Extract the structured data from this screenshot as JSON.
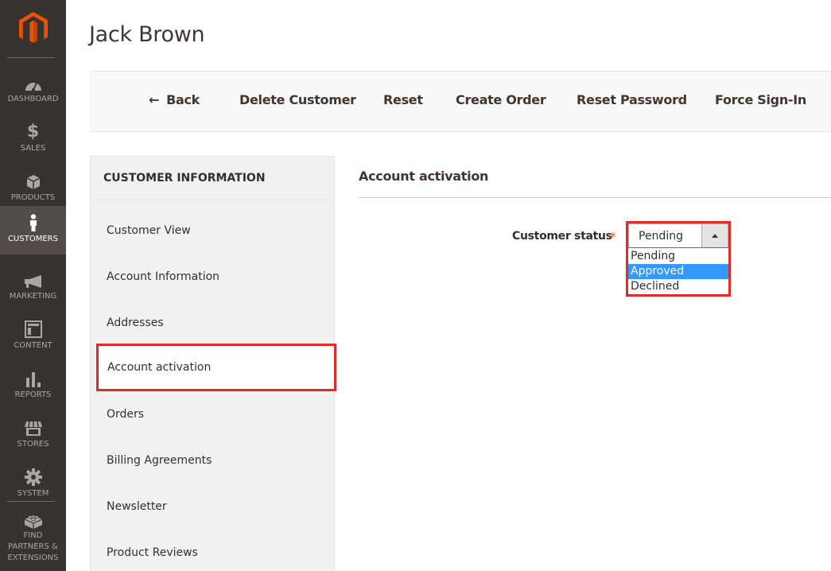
{
  "nav": {
    "items": [
      {
        "label": "Dashboard",
        "icon": "dashboard-gauge-icon"
      },
      {
        "label": "Sales",
        "icon": "dollar-icon"
      },
      {
        "label": "Products",
        "icon": "box-icon"
      },
      {
        "label": "Customers",
        "icon": "person-icon",
        "active": true
      },
      {
        "label": "Marketing",
        "icon": "megaphone-icon"
      },
      {
        "label": "Content",
        "icon": "layout-icon"
      },
      {
        "label": "Reports",
        "icon": "bar-chart-icon"
      },
      {
        "label": "Stores",
        "icon": "storefront-icon"
      },
      {
        "label": "System",
        "icon": "gear-icon"
      },
      {
        "label": "Find Partners & Extensions",
        "icon": "lego-brick-icon"
      }
    ]
  },
  "page": {
    "title": "Jack Brown"
  },
  "actions": {
    "back": "Back",
    "delete_customer": "Delete Customer",
    "reset": "Reset",
    "create_order": "Create Order",
    "reset_password": "Reset Password",
    "force_sign_in": "Force Sign-In"
  },
  "tabs": {
    "title": "Customer Information",
    "items": [
      {
        "label": "Customer View"
      },
      {
        "label": "Account Information"
      },
      {
        "label": "Addresses"
      },
      {
        "label": "Account activation",
        "active": true
      },
      {
        "label": "Orders"
      },
      {
        "label": "Billing Agreements"
      },
      {
        "label": "Newsletter"
      },
      {
        "label": "Product Reviews"
      }
    ]
  },
  "section": {
    "title": "Account activation",
    "field": {
      "label": "Customer status",
      "required_mark": "*",
      "value": "Pending",
      "options": [
        "Pending",
        "Approved",
        "Declined"
      ],
      "highlighted_option": "Approved"
    }
  },
  "colors": {
    "brand_orange": "#eb5202",
    "nav_bg": "#373330",
    "highlight_red": "#e02b27",
    "option_highlight": "#3399ff"
  }
}
